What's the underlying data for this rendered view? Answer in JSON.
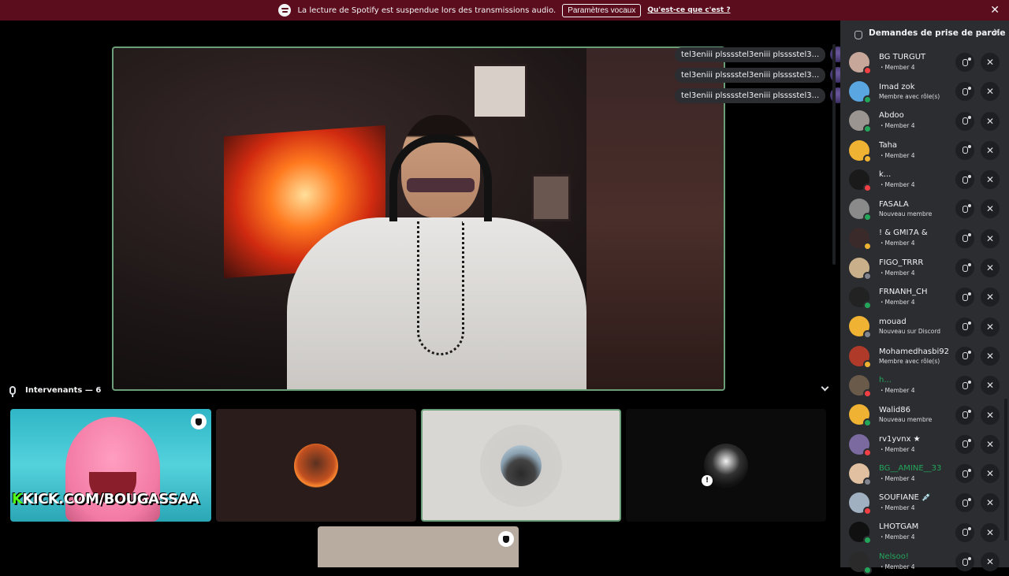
{
  "notice": {
    "message": "La lecture de Spotify est suspendue lors des transmissions audio.",
    "button_label": "Paramètres vocaux",
    "link_label": "Qu'est-ce que c'est ?",
    "close": "✕"
  },
  "chat_bubbles": [
    "tel3eniii plsssstel3eniii plsssstel3...",
    "tel3eniii plsssstel3eniii plsssstel3...",
    "tel3eniii plsssstel3eniii plsssstel3..."
  ],
  "speakers": {
    "label": "Intervenants — 6",
    "kick_text_k": "K",
    "kick_text": "KICK.COM/BOUGASSAA",
    "badge": "!"
  },
  "panel": {
    "title": "Demandes de prise de parole",
    "close": "✕",
    "accept_symbol": "",
    "deny_symbol": "✕",
    "requests": [
      {
        "name": "BG TURGUT",
        "role": "・Member 4",
        "avatar_color": "#c7a79a",
        "status_color": "#f23f43",
        "name_color": "#f2f3f5"
      },
      {
        "name": "Imad zok",
        "role": "Membre avec rôle(s)",
        "avatar_color": "#5aa6e0",
        "status_color": "#23a55a",
        "name_color": "#f2f3f5"
      },
      {
        "name": "Abdoo",
        "role": "・Member 4",
        "avatar_color": "#9a9590",
        "status_color": "#23a55a",
        "name_color": "#f2f3f5"
      },
      {
        "name": "Taha",
        "role": "・Member 4",
        "avatar_color": "#f0b232",
        "status_color": "#f0b232",
        "name_color": "#f2f3f5"
      },
      {
        "name": "k...",
        "role": "・Member 4",
        "avatar_color": "#1a1a1a",
        "status_color": "#f23f43",
        "name_color": "#f2f3f5"
      },
      {
        "name": "FASALA",
        "role": "Nouveau membre",
        "avatar_color": "#8a8a8a",
        "status_color": "#23a55a",
        "name_color": "#f2f3f5"
      },
      {
        "name": "! & GMI7A &",
        "role": "・Member 4",
        "avatar_color": "#3a2a2a",
        "status_color": "#f0b232",
        "name_color": "#f2f3f5"
      },
      {
        "name": "FIGO_TRRR",
        "role": "・Member 4",
        "avatar_color": "#c9b08a",
        "status_color": "#80848e",
        "name_color": "#f2f3f5"
      },
      {
        "name": "FRNANH_CH",
        "role": "・Member 4",
        "avatar_color": "#222222",
        "status_color": "#23a55a",
        "name_color": "#f2f3f5"
      },
      {
        "name": "mouad",
        "role": "Nouveau sur Discord",
        "avatar_color": "#f0b232",
        "status_color": "#80848e",
        "name_color": "#f2f3f5"
      },
      {
        "name": "Mohamedhasbi92",
        "role": "Membre avec rôle(s)",
        "avatar_color": "#b03a2a",
        "status_color": "#f0b232",
        "name_color": "#f2f3f5"
      },
      {
        "name": "h...",
        "role": "・Member 4",
        "avatar_color": "#6a5a4a",
        "status_color": "#f23f43",
        "name_color": "#23a55a"
      },
      {
        "name": "Walid86",
        "role": "Nouveau membre",
        "avatar_color": "#f0b232",
        "status_color": "#23a55a",
        "name_color": "#f2f3f5"
      },
      {
        "name": "rv1yvnx ★",
        "role": "・Member 4",
        "avatar_color": "#7a6aa0",
        "status_color": "#f23f43",
        "name_color": "#f2f3f5"
      },
      {
        "name": "BG__AMINE__33",
        "role": "・Member 4",
        "avatar_color": "#e0c0a0",
        "status_color": "#80848e",
        "name_color": "#23a55a"
      },
      {
        "name": "SOUFIANE 💉",
        "role": "・Member 4",
        "avatar_color": "#a0b0c0",
        "status_color": "#f23f43",
        "name_color": "#f2f3f5"
      },
      {
        "name": "LHOTGAM",
        "role": "・Member 4",
        "avatar_color": "#101010",
        "status_color": "#23a55a",
        "name_color": "#f2f3f5"
      },
      {
        "name": "Nelsoo!",
        "role": "・Member 4",
        "avatar_color": "#2a2a2a",
        "status_color": "#23a55a",
        "name_color": "#23a55a"
      }
    ]
  }
}
